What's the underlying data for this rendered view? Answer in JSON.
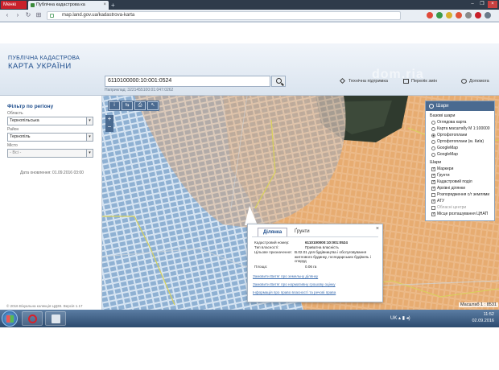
{
  "browser": {
    "menu_label": "Меню",
    "tab_title": "Публічна кадастрова ка",
    "tab_close": "×",
    "new_tab": "+",
    "url": "map.land.gov.ua/kadastrova-karta",
    "window_controls": [
      "–",
      "❐",
      "×"
    ]
  },
  "header": {
    "brand_line1": "ПУБЛІЧНА КАДАСТРОВА",
    "brand_line2": "КАРТА УКРАЇНИ",
    "search_value": "6110100000:10:001:0524",
    "search_hint": "Наприклад: 3221455100:01:047:0262",
    "links": [
      {
        "label": "Технічна підтримка",
        "icon": "wrench-icon"
      },
      {
        "label": "Перелік змін",
        "icon": "list-icon"
      },
      {
        "label": "Допомога",
        "icon": "help-icon"
      }
    ],
    "watermark": "dom.ria"
  },
  "filter": {
    "title": "Фільтр по регіону",
    "region_label": "Область",
    "region_value": "Тернопільська",
    "district_label": "Район",
    "district_value": "Тернопіль",
    "city_label": "Місто",
    "city_value": "- Всі -",
    "update_date": "Дата оновлення: 01.09.2016 03:00",
    "copyright": "© 2016 Візуальна колекція ЦДЗК. Версія 1.17"
  },
  "map_tools": {
    "tools": [
      "i",
      "⇆",
      "⎙",
      "↖"
    ],
    "zoom_in": "+",
    "zoom_out": "−"
  },
  "layers": {
    "title": "Шари",
    "base_title": "Базові шари",
    "base_layers": [
      {
        "label": "Оглядова карта",
        "selected": false
      },
      {
        "label": "Карта масштабу М 1:100000",
        "selected": false
      },
      {
        "label": "Ортофотоплани",
        "selected": true
      },
      {
        "label": "Ортофотоплани (м. Київ)",
        "selected": false
      },
      {
        "label": "GoogleMap",
        "selected": false
      },
      {
        "label": "GoogleMap",
        "selected": false
      }
    ],
    "layers_title": "Шари",
    "overlay_layers": [
      {
        "label": "Маркери",
        "checked": true,
        "color": ""
      },
      {
        "label": "Ґрунти",
        "checked": true,
        "color": ""
      },
      {
        "label": "Кадастровий поділ",
        "checked": true,
        "color": "#2a6fcf"
      },
      {
        "label": "Архівні ділянки",
        "checked": true,
        "color": "#c87bd0"
      },
      {
        "label": "Розпорядження с/г землями",
        "checked": false,
        "color": ""
      },
      {
        "label": "АТУ",
        "checked": true,
        "color": "#e0b040"
      },
      {
        "label": "Обласні центри",
        "checked": false,
        "color": ""
      },
      {
        "label": "Місце розташування ЦНАП",
        "checked": true,
        "color": "#3a8a3a"
      }
    ]
  },
  "popup": {
    "tab_active": "Ділянка",
    "tab_inactive": "Ґрунти",
    "close": "×",
    "rows": [
      {
        "label": "Кадастровий номер:",
        "value": "6110100000:10:001:0524"
      },
      {
        "label": "Тип власності:",
        "value": "Приватна власність"
      },
      {
        "label": "Цільове призначення:",
        "value": "В.02.01 для будівництва і обслуговування житлового будинку, господарських будівель і споруд"
      },
      {
        "label": "Площа:",
        "value": "0.06 га"
      }
    ],
    "links": [
      "Замовити Витяг про земельну ділянку",
      "Замовити Витяг про нормативну грошову оцінку",
      "Інформація про право власності та речові права"
    ]
  },
  "status": {
    "scale": "Масштаб 1 : 8531"
  },
  "taskbar": {
    "lang": "UK",
    "time": "11:52",
    "date": "02.09.2016"
  },
  "colors": {
    "brand_blue": "#1e4d8c",
    "toolbar_blue": "#4a6a90",
    "soil_orange": "#e8a565",
    "parcel_blue": "#8fb3d6"
  }
}
